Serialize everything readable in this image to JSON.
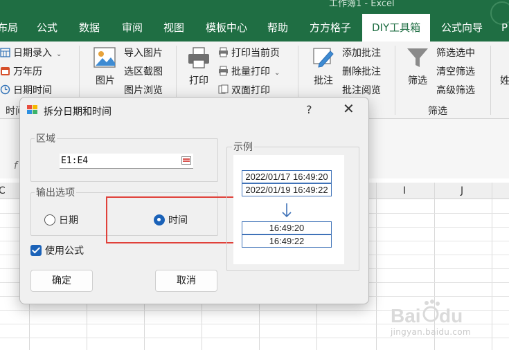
{
  "window": {
    "title": "工作簿1 - Excel"
  },
  "tabs": [
    {
      "label": "布局"
    },
    {
      "label": "公式"
    },
    {
      "label": "数据"
    },
    {
      "label": "审阅"
    },
    {
      "label": "视图"
    },
    {
      "label": "模板中心"
    },
    {
      "label": "帮助"
    },
    {
      "label": "方方格子"
    },
    {
      "label": "DIY工具箱",
      "active": true
    },
    {
      "label": "公式向导"
    },
    {
      "label": "P"
    }
  ],
  "ribbon": {
    "date_group": {
      "items": [
        "日期录入",
        "万年历",
        "日期时间"
      ],
      "label": "时间"
    },
    "picture_group": {
      "big_label": "图片",
      "items": [
        "导入图片",
        "选区截图",
        "图片浏览"
      ]
    },
    "print_group": {
      "big_label": "打印",
      "items": [
        "打印当前页",
        "批量打印",
        "双面打印"
      ]
    },
    "comment_group": {
      "big_label": "批注",
      "items": [
        "添加批注",
        "删除批注",
        "批注阅览"
      ]
    },
    "filter_group": {
      "big_label": "筛选",
      "items": [
        "筛选选中",
        "清空筛选",
        "高级筛选"
      ],
      "label": "筛选"
    },
    "right_cut": "姓"
  },
  "grid": {
    "name_box_fx": "f",
    "columns": [
      "C",
      "I",
      "J"
    ]
  },
  "dialog": {
    "title": "拆分日期和时间",
    "help": "?",
    "close": "✕",
    "region_label": "区域",
    "range_value": "E1:E4",
    "output_label": "输出选项",
    "option_date": "日期",
    "option_time": "时间",
    "selected_option": "时间",
    "use_formula_label": "使用公式",
    "use_formula_checked": true,
    "ok": "确定",
    "cancel": "取消",
    "example": {
      "label": "示例",
      "inputs": [
        "2022/01/17 16:49:20",
        "2022/01/19 16:49:22"
      ],
      "outputs": [
        "16:49:20",
        "16:49:22"
      ]
    }
  },
  "watermark": {
    "logo": "Baidu经验",
    "url": "jingyan.baidu.com"
  },
  "colors": {
    "excel_green": "#1f6e43",
    "accent_blue": "#1b62b8",
    "highlight_red": "#e0413a"
  }
}
